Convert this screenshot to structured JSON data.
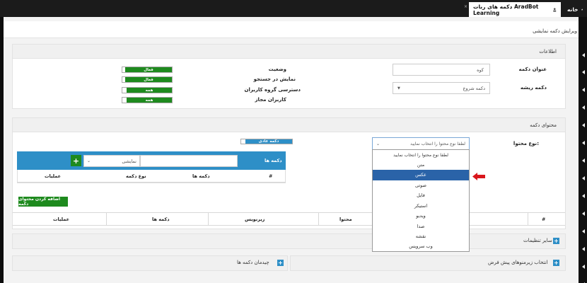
{
  "tabs": [
    {
      "label": "خانه",
      "icon": "home-icon"
    },
    {
      "label": "دکمه های ربات AradBot Learning",
      "icon": "robot-icon"
    }
  ],
  "page_title": "ویرایش دکمه نمایشی",
  "info_panel": {
    "title": "اطلاعات",
    "button_title_label": "عنوان دکمه",
    "button_title_value": "کوه",
    "root_button_label": "دکمه ریشه",
    "root_button_value": "دکمه شروع",
    "status_label": "وضعیت",
    "status_value": "فعال",
    "search_visible_label": "نمایش در جستجو",
    "search_visible_value": "فعال",
    "user_group_access_label": "دسترسی گروه کاربران",
    "user_group_access_value": "همه",
    "allowed_users_label": "کاربران مجاز",
    "allowed_users_value": "همه"
  },
  "content_panel": {
    "title": "محتوای دکمه",
    "content_type_label": "نوع محتوا:",
    "content_type_placeholder": "لطفا نوع محتوا را انتخاب نمایید",
    "regular_button_toggle": "دکمه عادی",
    "inner_table": {
      "buttons_label": "دکمه ها",
      "display_select_value": "نمایشی",
      "headers": [
        "#",
        "دکمه ها",
        "نوع دکمه",
        "عملیات"
      ]
    },
    "add_content_button": "اضافه کردن محتوای دکمه",
    "content_table_headers": [
      "#",
      "محتوا",
      "زیرنویس",
      "دکمه ها",
      "عملیات"
    ]
  },
  "dropdown_options": [
    "لطفا نوع محتوا را انتخاب نمایید",
    "متن",
    "عکس",
    "صوتی",
    "فایل",
    "استیکر",
    "ویدیو",
    "صدا",
    "نقشه",
    "وب سرویس"
  ],
  "dropdown_selected": "عکس",
  "other_settings": "سایر تنظیمات",
  "default_submenu": "انتخاب زیرمنوهای پیش فرض",
  "button_layout": "چیدمان دکمه ها",
  "colors": {
    "accent": "#2e8fc7",
    "green": "#1e8a1e",
    "selected": "#2a63a8",
    "arrow": "#d9161c"
  }
}
